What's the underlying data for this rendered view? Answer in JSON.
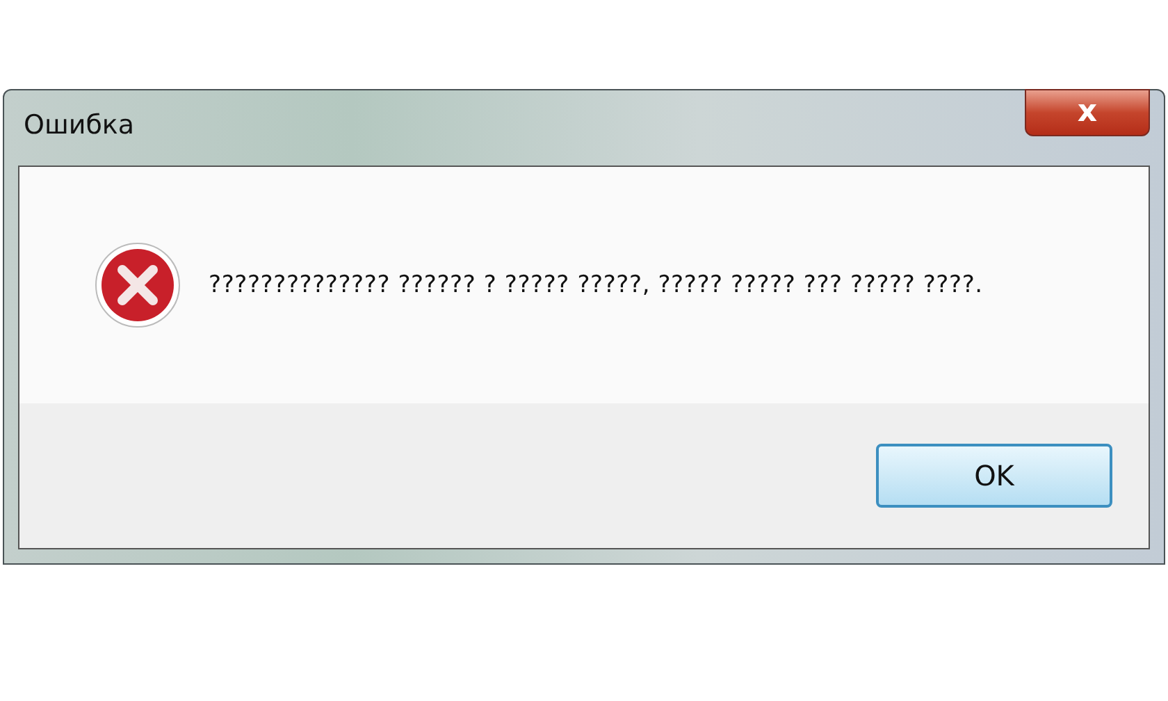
{
  "window": {
    "title": "Ошибка",
    "close_label": "x"
  },
  "message": "?????????????? ?????? ? ????? ?????, ????? ????? ??? ????? ????.",
  "buttons": [
    {
      "label": "OK",
      "default": true
    }
  ]
}
